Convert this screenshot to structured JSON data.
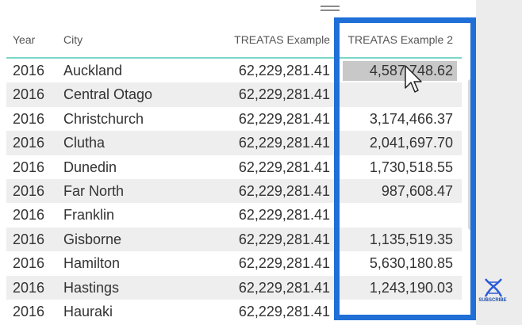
{
  "table": {
    "headers": {
      "year": "Year",
      "city": "City",
      "treatas1": "TREATAS Example",
      "treatas2": "TREATAS Example 2"
    },
    "rows": [
      {
        "year": "2016",
        "city": "Auckland",
        "treatas1": "62,229,281.41",
        "treatas2": "4,587,748.62"
      },
      {
        "year": "2016",
        "city": "Central Otago",
        "treatas1": "62,229,281.41",
        "treatas2": ""
      },
      {
        "year": "2016",
        "city": "Christchurch",
        "treatas1": "62,229,281.41",
        "treatas2": "3,174,466.37"
      },
      {
        "year": "2016",
        "city": "Clutha",
        "treatas1": "62,229,281.41",
        "treatas2": "2,041,697.70"
      },
      {
        "year": "2016",
        "city": "Dunedin",
        "treatas1": "62,229,281.41",
        "treatas2": "1,730,518.55"
      },
      {
        "year": "2016",
        "city": "Far North",
        "treatas1": "62,229,281.41",
        "treatas2": "987,608.47"
      },
      {
        "year": "2016",
        "city": "Franklin",
        "treatas1": "62,229,281.41",
        "treatas2": ""
      },
      {
        "year": "2016",
        "city": "Gisborne",
        "treatas1": "62,229,281.41",
        "treatas2": "1,135,519.35"
      },
      {
        "year": "2016",
        "city": "Hamilton",
        "treatas1": "62,229,281.41",
        "treatas2": "5,630,180.85"
      },
      {
        "year": "2016",
        "city": "Hastings",
        "treatas1": "62,229,281.41",
        "treatas2": "1,243,190.03"
      },
      {
        "year": "2016",
        "city": "Hauraki",
        "treatas1": "62,229,281.41",
        "treatas2": ""
      }
    ]
  },
  "highlight_color": "#1f6fd6",
  "header_underline_color": "#7ad6c8",
  "subscribe": {
    "label": "SUBSCRIBE",
    "icon": "dna-icon"
  }
}
